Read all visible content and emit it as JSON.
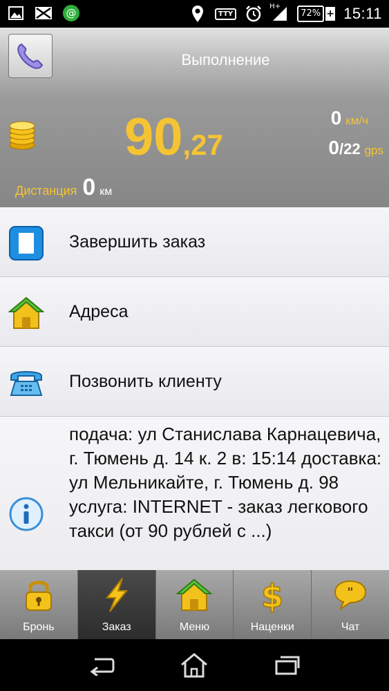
{
  "status_bar": {
    "tty": "TTY",
    "network": "H+",
    "battery": "72%",
    "time": "15:11"
  },
  "header": {
    "title": "Выполнение",
    "fare_main": "90",
    "fare_cents": ",27",
    "speed_value": "0",
    "speed_unit": "км/ч",
    "gps_value": "0",
    "gps_total": "/22",
    "gps_unit": "gps",
    "distance_label": "Дистанция",
    "distance_value": "0",
    "distance_unit": "км"
  },
  "menu": {
    "items": [
      {
        "label": "Завершить заказ",
        "icon": "finish-order-icon"
      },
      {
        "label": "Адреса",
        "icon": "house-icon"
      },
      {
        "label": "Позвонить клиенту",
        "icon": "telephone-icon"
      }
    ],
    "info_text": "подача: ул Станислава Карнацевича, г. Тюмень д. 14 к. 2 в: 15:14 доставка: ул Мельникайте, г. Тюмень д. 98   услуга: INTERNET - заказ легкового такси (от 90 рублей с ...)"
  },
  "tabs": [
    {
      "label": "Бронь",
      "icon": "lock-icon",
      "active": false
    },
    {
      "label": "Заказ",
      "icon": "lightning-icon",
      "active": true
    },
    {
      "label": "Меню",
      "icon": "house-icon",
      "active": false
    },
    {
      "label": "Наценки",
      "icon": "dollar-icon",
      "active": false
    },
    {
      "label": "Чат",
      "icon": "chat-bubble-icon",
      "active": false
    }
  ],
  "colors": {
    "accent": "#f5c433",
    "header_bg": "#9a9a9a",
    "list_bg": "#f1f1f4",
    "tab_active": "#2c2c2c"
  }
}
